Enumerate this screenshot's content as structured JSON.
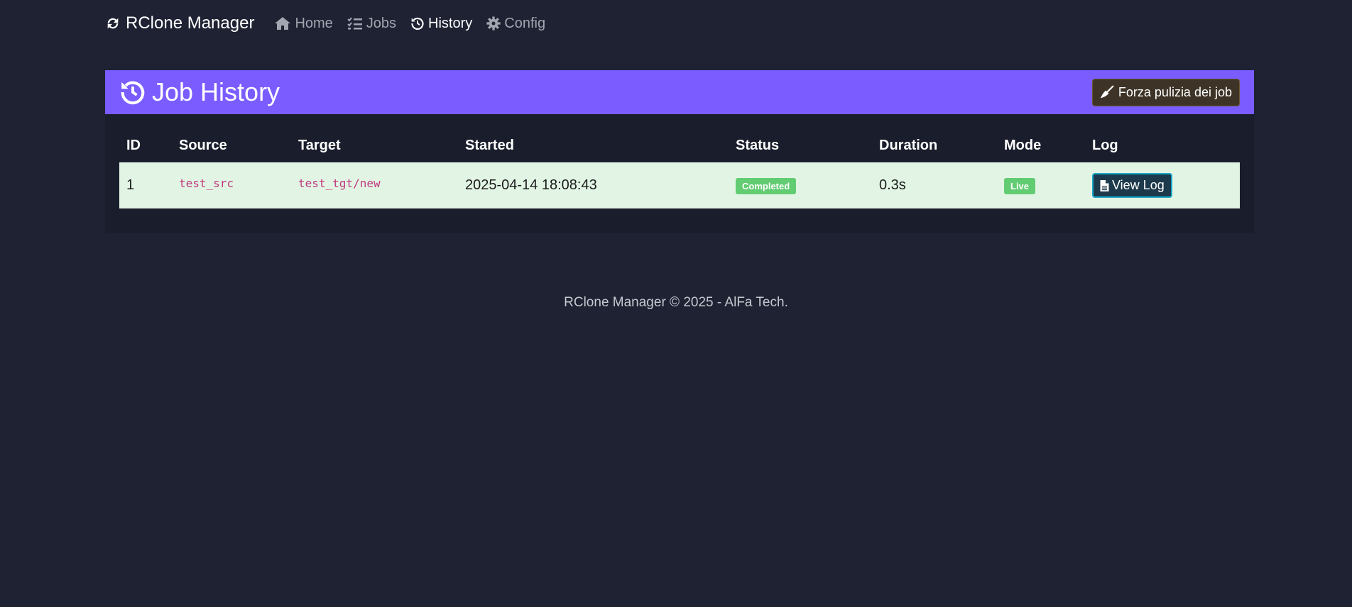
{
  "nav": {
    "brand": "RClone Manager",
    "items": [
      {
        "label": "Home",
        "icon": "home-icon"
      },
      {
        "label": "Jobs",
        "icon": "tasks-icon"
      },
      {
        "label": "History",
        "icon": "history-icon",
        "active": true
      },
      {
        "label": "Config",
        "icon": "gear-icon"
      }
    ]
  },
  "card": {
    "title": "Job History",
    "purge_button": "Forza pulizia dei job"
  },
  "table": {
    "headers": [
      "ID",
      "Source",
      "Target",
      "Started",
      "Status",
      "Duration",
      "Mode",
      "Log"
    ],
    "rows": [
      {
        "id": "1",
        "source": "test_src",
        "target": "test_tgt/new",
        "started": "2025-04-14 18:08:43",
        "status": "Completed",
        "duration": "0.3s",
        "mode": "Live",
        "log_button": "View Log"
      }
    ]
  },
  "footer": "RClone Manager © 2025 - AlFa Tech.",
  "colors": {
    "background": "#1e2233",
    "header_accent": "#7a5cff",
    "success_badge": "#62cc72",
    "row_highlight": "#e2f5e4",
    "code_text": "#c0397f"
  }
}
